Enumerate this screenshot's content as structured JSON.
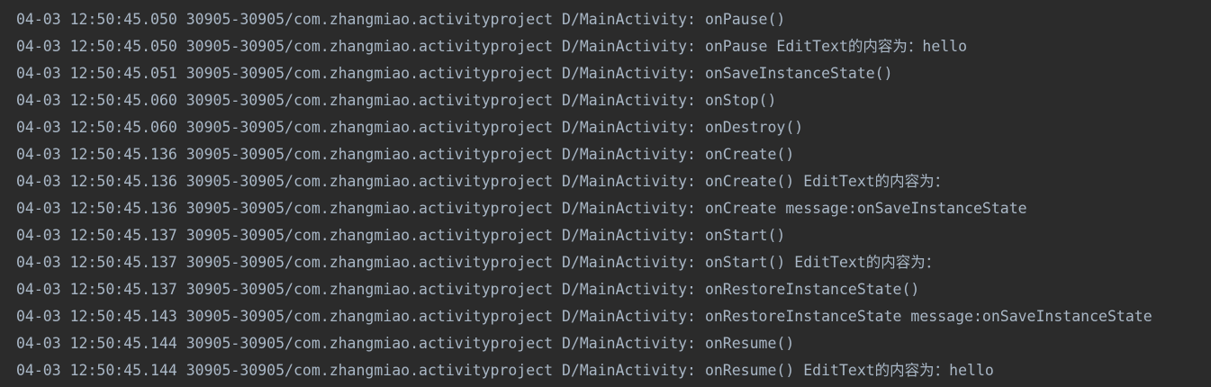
{
  "colors": {
    "background": "#2b2b2b",
    "log_text": "#a9b7c6"
  },
  "logcat": {
    "lines": [
      {
        "timestamp": "04-03 12:50:45.050",
        "pid_tid": "30905-30905/com.zhangmiao.activityproject",
        "tag": "D/MainActivity:",
        "message": "onPause()"
      },
      {
        "timestamp": "04-03 12:50:45.050",
        "pid_tid": "30905-30905/com.zhangmiao.activityproject",
        "tag": "D/MainActivity:",
        "message": "onPause EditText的内容为：hello"
      },
      {
        "timestamp": "04-03 12:50:45.051",
        "pid_tid": "30905-30905/com.zhangmiao.activityproject",
        "tag": "D/MainActivity:",
        "message": "onSaveInstanceState()"
      },
      {
        "timestamp": "04-03 12:50:45.060",
        "pid_tid": "30905-30905/com.zhangmiao.activityproject",
        "tag": "D/MainActivity:",
        "message": "onStop()"
      },
      {
        "timestamp": "04-03 12:50:45.060",
        "pid_tid": "30905-30905/com.zhangmiao.activityproject",
        "tag": "D/MainActivity:",
        "message": "onDestroy()"
      },
      {
        "timestamp": "04-03 12:50:45.136",
        "pid_tid": "30905-30905/com.zhangmiao.activityproject",
        "tag": "D/MainActivity:",
        "message": "onCreate()"
      },
      {
        "timestamp": "04-03 12:50:45.136",
        "pid_tid": "30905-30905/com.zhangmiao.activityproject",
        "tag": "D/MainActivity:",
        "message": "onCreate() EditText的内容为："
      },
      {
        "timestamp": "04-03 12:50:45.136",
        "pid_tid": "30905-30905/com.zhangmiao.activityproject",
        "tag": "D/MainActivity:",
        "message": "onCreate message:onSaveInstanceState"
      },
      {
        "timestamp": "04-03 12:50:45.137",
        "pid_tid": "30905-30905/com.zhangmiao.activityproject",
        "tag": "D/MainActivity:",
        "message": "onStart()"
      },
      {
        "timestamp": "04-03 12:50:45.137",
        "pid_tid": "30905-30905/com.zhangmiao.activityproject",
        "tag": "D/MainActivity:",
        "message": "onStart() EditText的内容为："
      },
      {
        "timestamp": "04-03 12:50:45.137",
        "pid_tid": "30905-30905/com.zhangmiao.activityproject",
        "tag": "D/MainActivity:",
        "message": "onRestoreInstanceState()"
      },
      {
        "timestamp": "04-03 12:50:45.143",
        "pid_tid": "30905-30905/com.zhangmiao.activityproject",
        "tag": "D/MainActivity:",
        "message": "onRestoreInstanceState message:onSaveInstanceState"
      },
      {
        "timestamp": "04-03 12:50:45.144",
        "pid_tid": "30905-30905/com.zhangmiao.activityproject",
        "tag": "D/MainActivity:",
        "message": "onResume()"
      },
      {
        "timestamp": "04-03 12:50:45.144",
        "pid_tid": "30905-30905/com.zhangmiao.activityproject",
        "tag": "D/MainActivity:",
        "message": "onResume() EditText的内容为：hello"
      }
    ]
  }
}
